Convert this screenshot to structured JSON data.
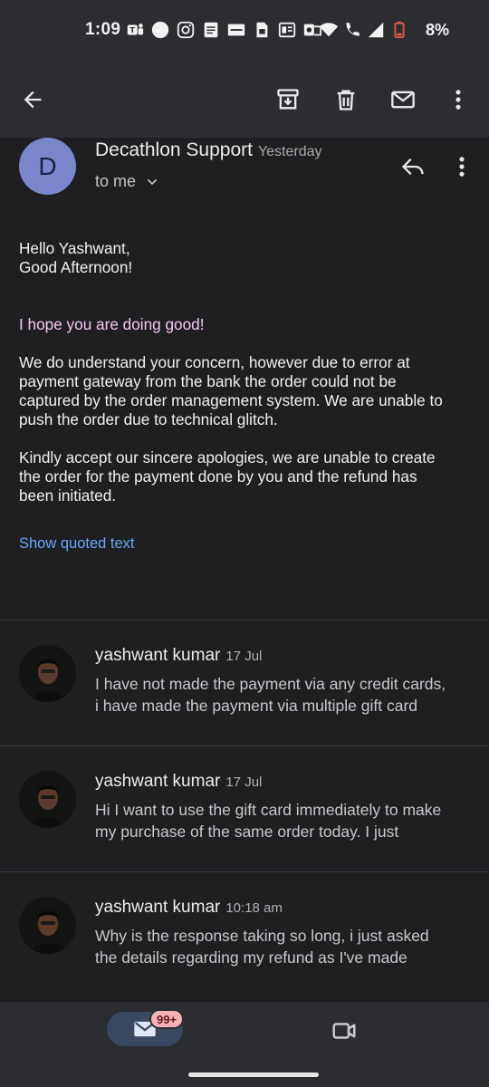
{
  "status_bar": {
    "time": "1:09",
    "battery": "8%",
    "notification_icons": [
      "teams-icon",
      "circle-icon",
      "instagram-icon",
      "docs-icon",
      "zomato-icon",
      "sim-icon",
      "office-icon",
      "outlook-icon"
    ]
  },
  "toolbar": {
    "back": "back-arrow-icon",
    "archive": "archive-icon",
    "delete": "trash-icon",
    "mark_unread": "mail-icon",
    "more": "more-vert-icon"
  },
  "email": {
    "avatar_letter": "D",
    "sender": "Decathlon Support",
    "date": "Yesterday",
    "recipient": "to me",
    "greeting": "Hello Yashwant,\nGood Afternoon!",
    "hope": "I hope you are doing good!",
    "paragraph1": "We do understand your concern, however due to error at\npayment gateway from the bank the order could not be\ncaptured by the order management system. We are unable to\npush the order due to technical glitch.",
    "paragraph2": "Kindly accept our sincere apologies, we are unable to create\nthe order for the payment done by you and the refund has\nbeen initiated.",
    "show_quoted": "Show quoted text"
  },
  "thread": [
    {
      "sender": "yashwant kumar",
      "time": "17 Jul",
      "snippet": "I have not made the payment via any credit cards,\ni have made the payment via multiple gift card"
    },
    {
      "sender": "yashwant kumar",
      "time": "17 Jul",
      "snippet": "Hi I want to use the gift card immediately to make\nmy purchase of the same order today. I just"
    },
    {
      "sender": "yashwant kumar",
      "time": "10:18 am",
      "snippet": "Why is the response taking so long, i just asked\nthe details regarding my refund as I've made"
    }
  ],
  "bottom_nav": {
    "mail_badge": "99+"
  },
  "colors": {
    "background": "#1f1f21",
    "chrome": "#2b2d31",
    "avatar": "#7986cb",
    "link": "#6aa6f5",
    "highlight_text": "#f5c6f1",
    "badge": "#f7b2b8"
  }
}
